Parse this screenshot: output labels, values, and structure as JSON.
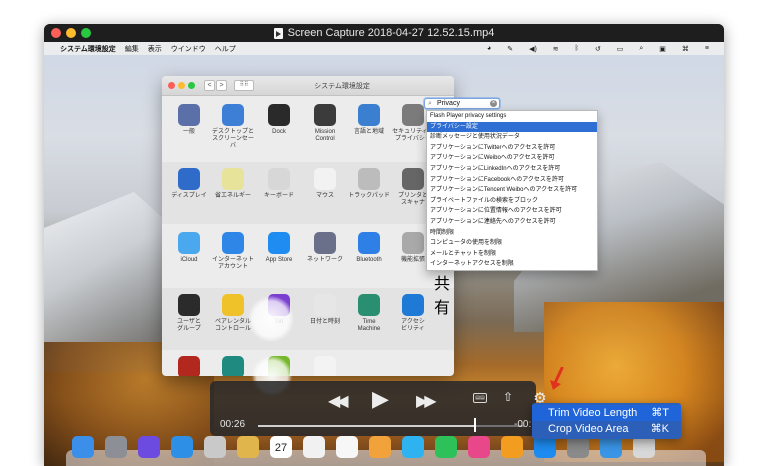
{
  "window": {
    "title": "Screen Capture 2018-04-27 12.52.15.mp4"
  },
  "recorded_menubar": {
    "app_name": "システム環境設定",
    "menus": [
      "編集",
      "表示",
      "ウインドウ",
      "ヘルプ"
    ],
    "status_icons": [
      "time-machine-icon",
      "pen-icon",
      "volume-icon",
      "wifi-icon",
      "bluetooth-icon",
      "history-icon",
      "battery-icon",
      "spotlight-icon",
      "keyboard-icon",
      "command-icon",
      "list-icon"
    ]
  },
  "system_preferences": {
    "title": "システム環境設定",
    "nav": {
      "back": "<",
      "forward": ">",
      "grid": "⠿⠿"
    },
    "search": {
      "value": "Privacy"
    },
    "rows": [
      [
        {
          "name": "general",
          "label": "一般",
          "color": "#5b6fa8"
        },
        {
          "name": "desktop",
          "label": "デスクトップと\nスクリーンセーバ",
          "color": "#3d7fd6"
        },
        {
          "name": "dock",
          "label": "Dock",
          "color": "#2a2a2a"
        },
        {
          "name": "mission-control",
          "label": "Mission\nControl",
          "color": "#3b3b3b"
        },
        {
          "name": "language",
          "label": "言語と地域",
          "color": "#3a7fd0"
        },
        {
          "name": "security",
          "label": "セキュリティと\nプライバシー",
          "color": "#7b7b7b"
        }
      ],
      [
        {
          "name": "displays",
          "label": "ディスプレイ",
          "color": "#2f6cc9"
        },
        {
          "name": "energy",
          "label": "省エネルギー",
          "color": "#e7e39a"
        },
        {
          "name": "keyboard",
          "label": "キーボード",
          "color": "#d7d7d7"
        },
        {
          "name": "mouse",
          "label": "マウス",
          "color": "#f2f2f2"
        },
        {
          "name": "trackpad",
          "label": "トラックパッド",
          "color": "#bcbcbc"
        },
        {
          "name": "printers",
          "label": "プリンタと\nスキャナ",
          "color": "#666666"
        }
      ],
      [
        {
          "name": "icloud",
          "label": "iCloud",
          "color": "#4aa8ee"
        },
        {
          "name": "internet-accounts",
          "label": "インターネット\nアカウント",
          "color": "#2e86e6"
        },
        {
          "name": "app-store",
          "label": "App Store",
          "color": "#1e8cf0"
        },
        {
          "name": "network",
          "label": "ネットワーク",
          "color": "#6a6f8a"
        },
        {
          "name": "bluetooth",
          "label": "Bluetooth",
          "color": "#2e7fe6"
        },
        {
          "name": "extensions",
          "label": "機能拡張",
          "color": "#a9a9a9"
        }
      ],
      [
        {
          "name": "users",
          "label": "ユーザと\nグループ",
          "color": "#2b2b2b"
        },
        {
          "name": "parental",
          "label": "ペアレンタル\nコントロール",
          "color": "#f0c22a"
        },
        {
          "name": "siri",
          "label": "Siri",
          "color": "#7b3fd0"
        },
        {
          "name": "date-time",
          "label": "日付と時刻",
          "color": "#e6e6e6"
        },
        {
          "name": "time-machine",
          "label": "Time\nMachine",
          "color": "#2a8f70"
        },
        {
          "name": "accessibility",
          "label": "アクセシ\nビリティ",
          "color": "#1f7ad6"
        }
      ],
      [
        {
          "name": "flash",
          "label": "",
          "color": "#b3281e"
        },
        {
          "name": "pref-teal",
          "label": "",
          "color": "#1f8a80"
        },
        {
          "name": "nvidia",
          "label": "",
          "color": "#76b82a"
        },
        {
          "name": "pref-white",
          "label": "",
          "color": "#f3f3f3"
        }
      ]
    ],
    "sharing_label_partial": "共有",
    "search_results": [
      "Flash Player privacy settings",
      "プライバシー設定",
      "診断メッセージと使用状況データ",
      "アプリケーションにTwitterへのアクセスを許可",
      "アプリケーションにWeiboへのアクセスを許可",
      "アプリケーションにLinkedInへのアクセスを許可",
      "アプリケーションにFacebookへのアクセスを許可",
      "アプリケーションにTencent Weiboへのアクセスを許可",
      "プライベートファイルの検索をブロック",
      "アプリケーションに位置情報へのアクセスを許可",
      "アプリケーションに連絡先へのアクセスを許可",
      "時間制限",
      "コンピュータの使用を制限",
      "メールとチャットを制限",
      "インターネットアクセスを制限"
    ],
    "selected_result_index": 1
  },
  "dock": {
    "items": [
      "finder",
      "launchpad",
      "siri",
      "safari",
      "preview",
      "notes-app",
      "calendar",
      "textedit",
      "reminders",
      "photos",
      "messages",
      "facetime",
      "itunes",
      "ibooks",
      "app-store",
      "system-preferences",
      "finder-folder",
      "trash"
    ],
    "calendar_day": "27"
  },
  "playback": {
    "current_time": "00:26",
    "remaining_time": "-00:",
    "progress": 0.82,
    "controls": {
      "rewind": "◀◀",
      "play": "▶",
      "forward": "▶▶"
    }
  },
  "share_menu": {
    "items": [
      {
        "label": "Trim Video Length",
        "shortcut": "⌘T"
      },
      {
        "label": "Crop Video Area",
        "shortcut": "⌘K"
      }
    ]
  },
  "colors": {
    "accent_blue": "#2b5fb8",
    "selection_blue": "#2f6fd4",
    "annotation_red": "#e0321e"
  }
}
